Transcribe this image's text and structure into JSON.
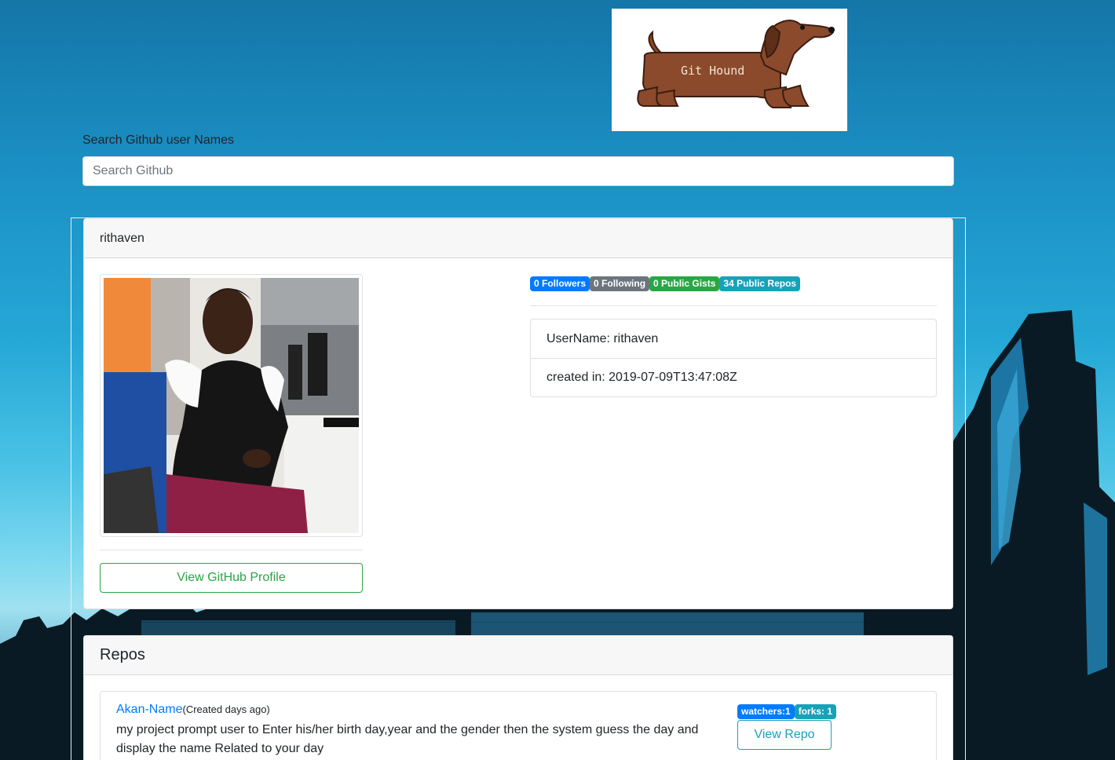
{
  "brand": {
    "logo_text": "Git Hound",
    "dog_color": "#8b4a2b"
  },
  "search": {
    "label": "Search Github user Names",
    "placeholder": "Search Github",
    "value": ""
  },
  "user": {
    "login": "rithaven",
    "badges": {
      "followers": "0 Followers",
      "following": "0 Following",
      "gists": "0 Public Gists",
      "repos": "34 Public Repos"
    },
    "details": {
      "username": "UserName: rithaven",
      "created": "created in: 2019-07-09T13:47:08Z"
    },
    "profile_button": "View GitHub Profile"
  },
  "repos": {
    "title": "Repos",
    "items": [
      {
        "name": "Akan-Name",
        "created": "(Created days ago)",
        "description": "my project prompt user to Enter his/her birth day,year and the gender then the system guess the day and display the name Related to your day",
        "watchers": "watchers:1",
        "forks": "forks: 1",
        "view_button": "View Repo"
      }
    ]
  },
  "colors": {
    "primary": "#007bff",
    "secondary": "#6c757d",
    "success": "#28a745",
    "info": "#17a2b8"
  }
}
